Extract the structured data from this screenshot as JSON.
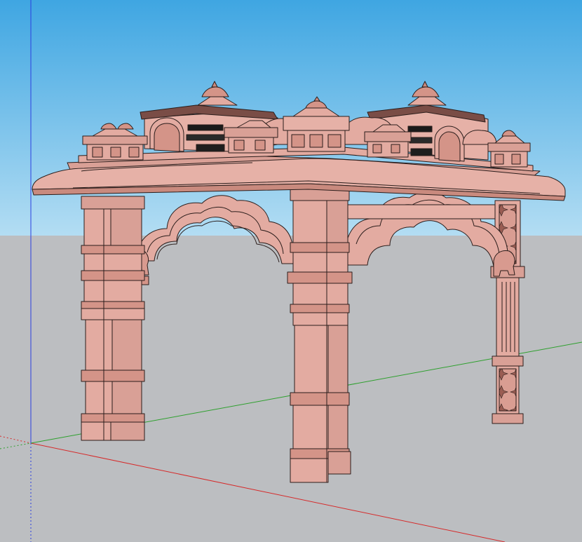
{
  "viewport": {
    "type": "3d-modeling-viewport",
    "model_name": "",
    "colors": {
      "sky_top": "#3fa6e2",
      "sky_bottom": "#a9d8f2",
      "ground": "#bcbec1",
      "stone": "#e3aba1",
      "stone_shade": "#c9897e",
      "stone_dark": "#b07468",
      "edge": "#2b1d1b",
      "axis_red": "#d62a2a",
      "axis_green": "#2ea02e",
      "axis_blue": "#2a3fe0"
    }
  }
}
